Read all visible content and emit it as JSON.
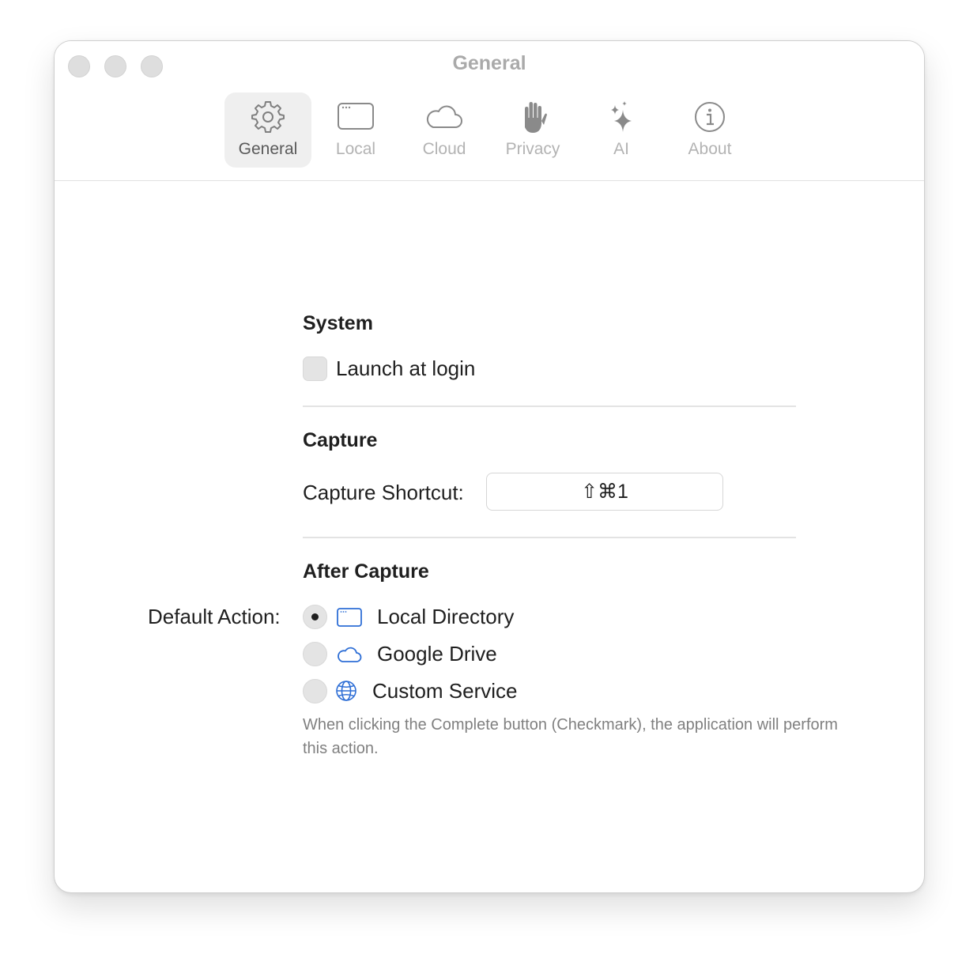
{
  "window": {
    "title": "General"
  },
  "toolbar": {
    "tabs": [
      {
        "label": "General",
        "icon": "gear-icon",
        "selected": true
      },
      {
        "label": "Local",
        "icon": "window-icon",
        "selected": false
      },
      {
        "label": "Cloud",
        "icon": "cloud-icon",
        "selected": false
      },
      {
        "label": "Privacy",
        "icon": "hand-raised-icon",
        "selected": false
      },
      {
        "label": "AI",
        "icon": "sparkles-icon",
        "selected": false
      },
      {
        "label": "About",
        "icon": "info-circle-icon",
        "selected": false
      }
    ]
  },
  "system": {
    "title": "System",
    "launch_at_login": {
      "label": "Launch at login",
      "checked": false
    }
  },
  "capture": {
    "title": "Capture",
    "shortcut_label": "Capture Shortcut:",
    "shortcut_value": "⇧⌘1"
  },
  "after_capture": {
    "title": "After Capture",
    "default_action_label": "Default Action:",
    "options": [
      {
        "label": "Local Directory",
        "icon": "window-icon",
        "selected": true
      },
      {
        "label": "Google Drive",
        "icon": "cloud-icon",
        "selected": false
      },
      {
        "label": "Custom Service",
        "icon": "globe-icon",
        "selected": false
      }
    ],
    "help": "When clicking the Complete button (Checkmark), the application will perform this action."
  },
  "colors": {
    "accent": "#2f6fd6",
    "tab_icon": "#8a8a8a",
    "disabled_text": "#b3b3b3"
  }
}
